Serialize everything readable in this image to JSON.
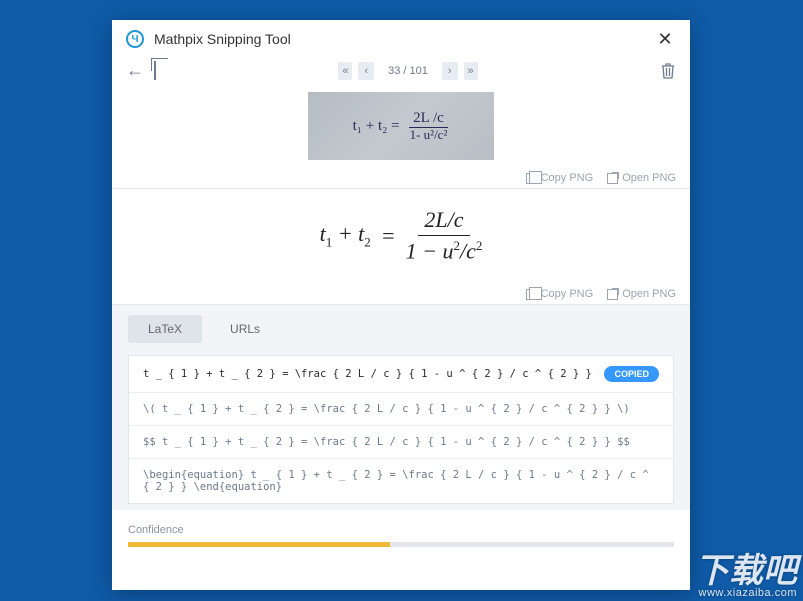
{
  "window": {
    "title": "Mathpix Snipping Tool"
  },
  "nav": {
    "page_current": 33,
    "page_total": 101,
    "page_label": "33 / 101"
  },
  "snippet": {
    "handwritten_left": "t₁ + t₂ =",
    "handwritten_frac_top": "2L /c",
    "handwritten_frac_bot": "1- u²/c²"
  },
  "actions": {
    "copy_png": "Copy PNG",
    "open_png": "Open PNG"
  },
  "render": {
    "left_t1": "t",
    "left_sub1": "1",
    "plus": "+",
    "left_t2": "t",
    "left_sub2": "2",
    "eq": "=",
    "frac_top": "2L/c",
    "frac_bot_pre": "1 − u",
    "frac_bot_sup": "2",
    "frac_bot_mid": "/c",
    "frac_bot_sup2": "2"
  },
  "tabs": {
    "latex": "LaTeX",
    "urls": "URLs"
  },
  "code": {
    "row1": "t _ { 1 } + t _ { 2 } = \\frac { 2 L / c } { 1 - u ^ { 2 } / c ^ { 2 } }",
    "row2": "\\( t _ { 1 } + t _ { 2 } = \\frac { 2 L / c } { 1 - u ^ { 2 } / c ^ { 2 } } \\)",
    "row3": "$$ t _ { 1 } + t _ { 2 } = \\frac { 2 L / c } { 1 - u ^ { 2 } / c ^ { 2 } } $$",
    "row4": "\\begin{equation} t _ { 1 } + t _ { 2 } = \\frac { 2 L / c } { 1 - u ^ { 2 } / c ^ { 2 } } \\end{equation}",
    "copied_badge": "COPIED"
  },
  "confidence": {
    "label": "Confidence",
    "value_pct": 48
  },
  "watermark": {
    "zh": "下载吧",
    "url": "www.xiazaiba.com"
  }
}
